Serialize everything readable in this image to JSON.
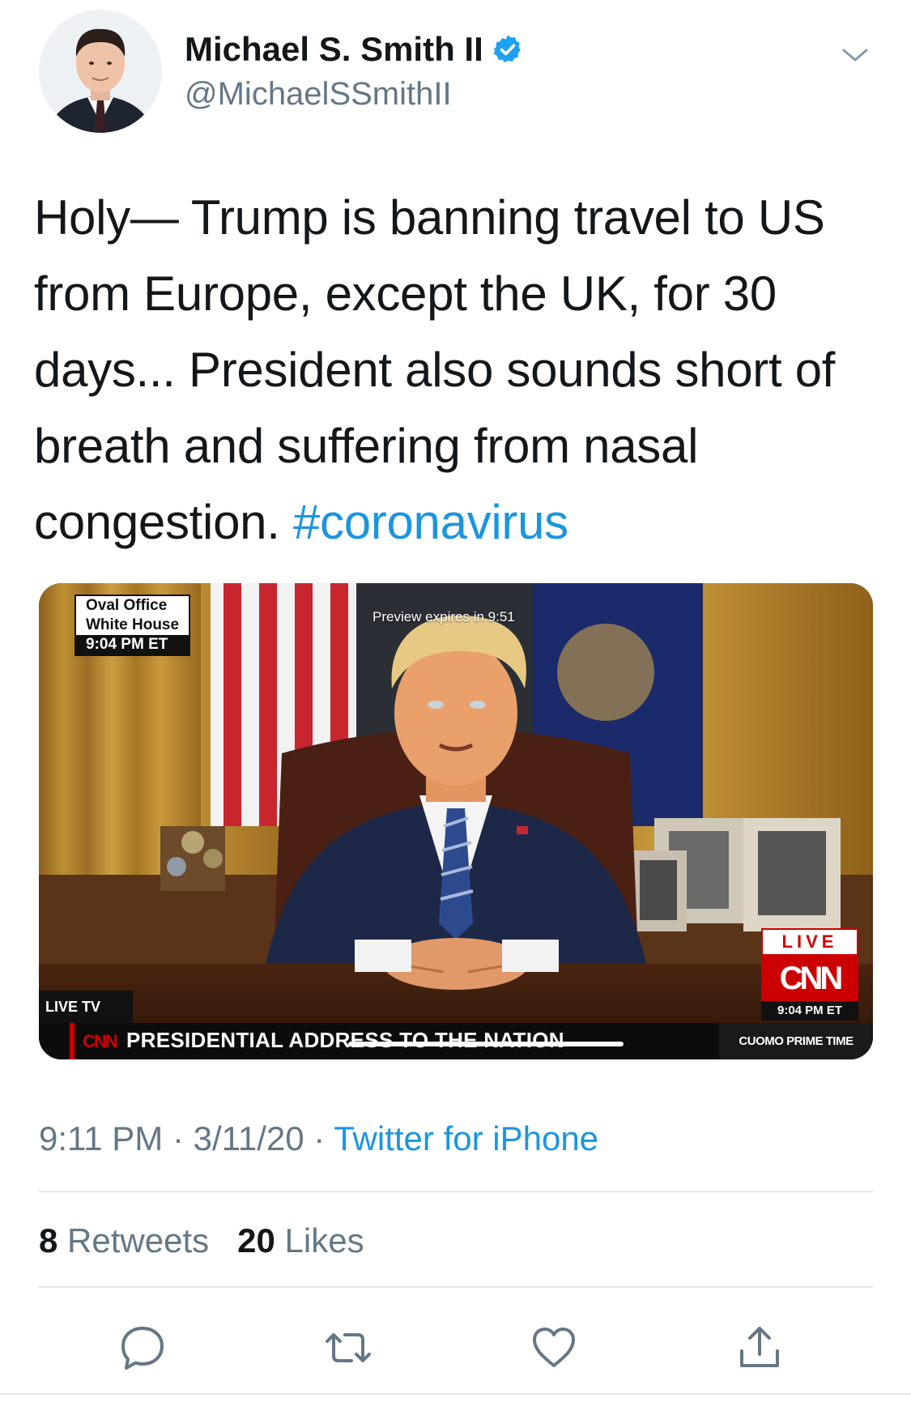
{
  "author": {
    "display_name": "Michael S. Smith II",
    "handle": "@MichaelSSmithII",
    "verified": true,
    "verified_color": "#1da1f2"
  },
  "tweet": {
    "text": "Holy— Trump is banning travel to US from Europe, except the UK, for 30 days... President also sounds short of breath and suffering from nasal congestion.",
    "hashtag": "#coronavirus",
    "link_color": "#1b95e0"
  },
  "media": {
    "location_line1": "Oval Office",
    "location_line2": "White House",
    "location_time": "9:04 PM ET",
    "preview_text": "Preview expires in 9:51",
    "live_tv": "LIVE TV",
    "chyron_logo": "CNN",
    "chyron_text": "PRESIDENTIAL ADDRESS TO THE NATION",
    "show_name": "CUOMO PRIME TIME",
    "live_label": "LIVE",
    "network_logo": "CNN",
    "broadcast_time": "9:04 PM ET",
    "progress_fraction": 0.33
  },
  "meta": {
    "time": "9:11 PM",
    "separator": " · ",
    "date": "3/11/20",
    "source": "Twitter for iPhone"
  },
  "stats": {
    "retweets_count": "8",
    "retweets_label": "Retweets",
    "likes_count": "20",
    "likes_label": "Likes"
  },
  "actions": {
    "reply": "reply-icon",
    "retweet": "retweet-icon",
    "like": "heart-icon",
    "share": "share-icon"
  }
}
